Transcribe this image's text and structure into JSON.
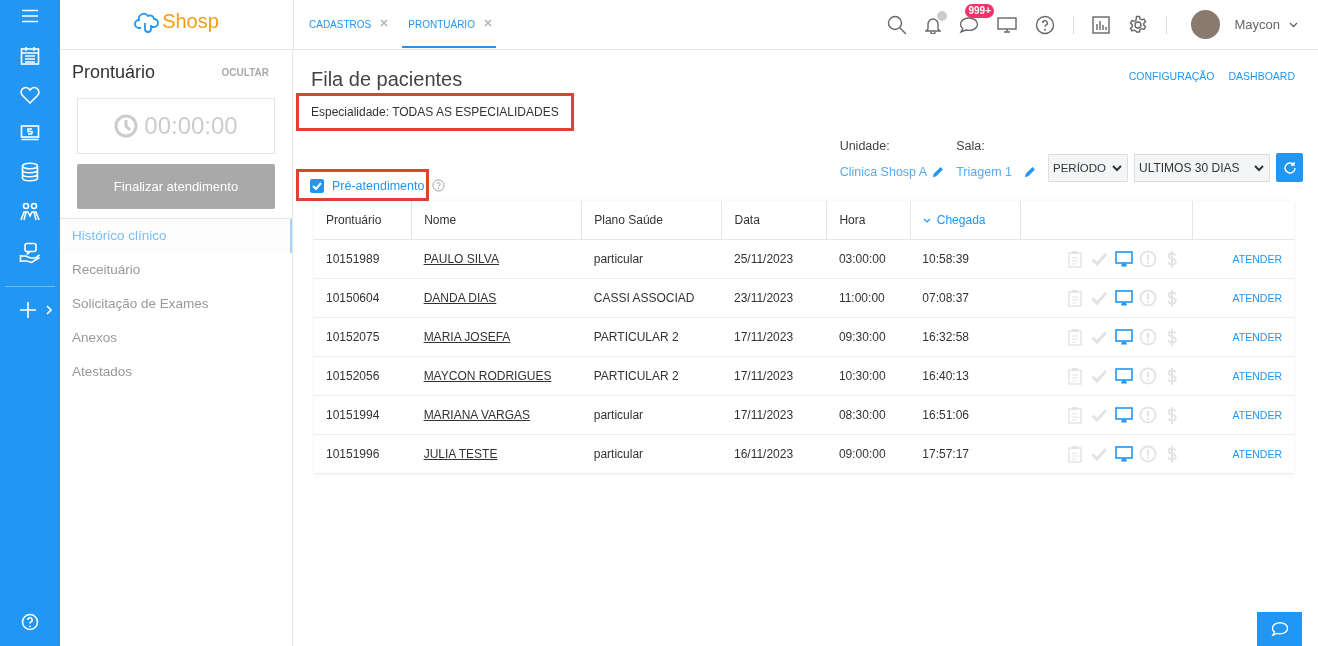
{
  "logo": {
    "text": "Shosp"
  },
  "tabs": [
    {
      "label": "CADASTROS",
      "selected": false
    },
    {
      "label": "PRONTUÁRIO",
      "selected": true
    }
  ],
  "header": {
    "messages_badge": "999+",
    "user_name": "Maycon"
  },
  "sidebar": {
    "title": "Prontuário",
    "hide_link": "OCULTAR",
    "timer": "00:00:00",
    "finish_button": {
      "label": "Finalizar atendimento",
      "disabled": true
    },
    "items": [
      {
        "label": "Histórico clínico",
        "selected": true
      },
      {
        "label": "Receituário",
        "selected": false
      },
      {
        "label": "Solicitação de Exames",
        "selected": false
      },
      {
        "label": "Anexos",
        "selected": false
      },
      {
        "label": "Atestados",
        "selected": false
      }
    ]
  },
  "main": {
    "title": "Fila de pacientes",
    "links": [
      "CONFIGURAÇÃO",
      "DASHBOARD"
    ],
    "specialty": {
      "text": "Especialidade: TODAS AS ESPECIALIDADES",
      "highlighted": true
    },
    "unit": {
      "label": "Unidade:",
      "value": "Clinica Shosp A"
    },
    "room": {
      "label": "Sala:",
      "value": "Triagem 1"
    },
    "selects": [
      "PERÍODO",
      "ULTIMOS 30 DIAS"
    ],
    "pre_service": {
      "label": "Pré-atendimento",
      "checked": true,
      "highlighted": true
    }
  },
  "table": {
    "columns": [
      {
        "label": "Prontuário",
        "sorted": false
      },
      {
        "label": "Nome",
        "sorted": false
      },
      {
        "label": "Plano Saúde",
        "sorted": false
      },
      {
        "label": "Data",
        "sorted": false
      },
      {
        "label": "Hora",
        "sorted": false
      },
      {
        "label": "Chegada",
        "sorted": true
      }
    ],
    "rows": [
      {
        "record": "10151989",
        "name": "PAULO SILVA",
        "plan": "particular",
        "date": "25/11/2023",
        "time": "03:00:00",
        "arrival": "10:58:39",
        "flags": [
          {
            "kind": "clipboard",
            "on": false
          },
          {
            "kind": "check",
            "on": false
          },
          {
            "kind": "monitor",
            "on": true
          },
          {
            "kind": "alert",
            "on": false
          },
          {
            "kind": "dollar",
            "on": false
          }
        ],
        "action": "ATENDER"
      },
      {
        "record": "10150604",
        "name": "DANDA DIAS",
        "plan": "CASSI ASSOCIAD",
        "date": "23/11/2023",
        "time": "11:00:00",
        "arrival": "07:08:37",
        "flags": [
          {
            "kind": "clipboard",
            "on": false
          },
          {
            "kind": "check",
            "on": false
          },
          {
            "kind": "monitor",
            "on": true
          },
          {
            "kind": "alert",
            "on": false
          },
          {
            "kind": "dollar",
            "on": false
          }
        ],
        "action": "ATENDER"
      },
      {
        "record": "10152075",
        "name": "MARIA JOSEFA",
        "plan": "PARTICULAR 2",
        "date": "17/11/2023",
        "time": "09:30:00",
        "arrival": "16:32:58",
        "flags": [
          {
            "kind": "clipboard",
            "on": false
          },
          {
            "kind": "check",
            "on": false
          },
          {
            "kind": "monitor",
            "on": true
          },
          {
            "kind": "alert",
            "on": false
          },
          {
            "kind": "dollar",
            "on": false
          }
        ],
        "action": "ATENDER"
      },
      {
        "record": "10152056",
        "name": "MAYCON RODRIGUES",
        "plan": "PARTICULAR 2",
        "date": "17/11/2023",
        "time": "10:30:00",
        "arrival": "16:40:13",
        "flags": [
          {
            "kind": "clipboard",
            "on": false
          },
          {
            "kind": "check",
            "on": false
          },
          {
            "kind": "monitor",
            "on": true
          },
          {
            "kind": "alert",
            "on": false
          },
          {
            "kind": "dollar",
            "on": false
          }
        ],
        "action": "ATENDER"
      },
      {
        "record": "10151994",
        "name": "MARIANA VARGAS",
        "plan": "particular",
        "date": "17/11/2023",
        "time": "08:30:00",
        "arrival": "16:51:06",
        "flags": [
          {
            "kind": "clipboard",
            "on": false
          },
          {
            "kind": "check",
            "on": false
          },
          {
            "kind": "monitor",
            "on": true
          },
          {
            "kind": "alert",
            "on": false
          },
          {
            "kind": "dollar",
            "on": false
          }
        ],
        "action": "ATENDER"
      },
      {
        "record": "10151996",
        "name": "JULIA TESTE",
        "plan": "particular",
        "date": "16/11/2023",
        "time": "09:00:00",
        "arrival": "17:57:17",
        "flags": [
          {
            "kind": "clipboard",
            "on": false
          },
          {
            "kind": "check",
            "on": false
          },
          {
            "kind": "monitor",
            "on": true
          },
          {
            "kind": "alert",
            "on": false
          },
          {
            "kind": "dollar",
            "on": false
          }
        ],
        "action": "ATENDER"
      }
    ]
  }
}
